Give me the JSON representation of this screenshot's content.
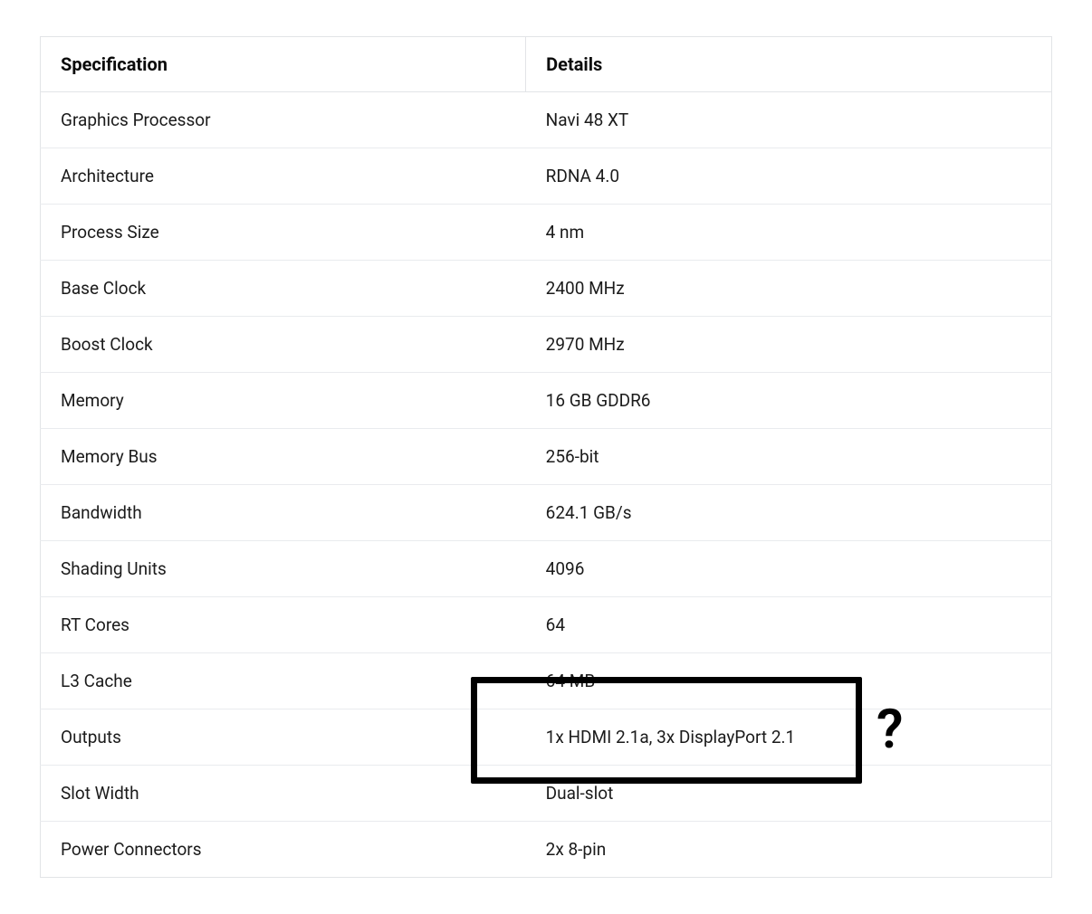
{
  "table": {
    "headers": {
      "spec": "Specification",
      "details": "Details"
    },
    "rows": [
      {
        "spec": "Graphics Processor",
        "details": "Navi 48 XT"
      },
      {
        "spec": "Architecture",
        "details": "RDNA 4.0"
      },
      {
        "spec": "Process Size",
        "details": "4 nm"
      },
      {
        "spec": "Base Clock",
        "details": "2400 MHz"
      },
      {
        "spec": "Boost Clock",
        "details": "2970 MHz"
      },
      {
        "spec": "Memory",
        "details": "16 GB GDDR6"
      },
      {
        "spec": "Memory Bus",
        "details": "256-bit"
      },
      {
        "spec": "Bandwidth",
        "details": "624.1 GB/s"
      },
      {
        "spec": "Shading Units",
        "details": "4096"
      },
      {
        "spec": "RT Cores",
        "details": "64"
      },
      {
        "spec": "L3 Cache",
        "details": "64 MB"
      },
      {
        "spec": "Outputs",
        "details": "1x HDMI 2.1a, 3x DisplayPort 2.1"
      },
      {
        "spec": "Slot Width",
        "details": "Dual-slot"
      },
      {
        "spec": "Power Connectors",
        "details": "2x 8-pin"
      }
    ]
  },
  "annotation": {
    "mark": "?"
  }
}
